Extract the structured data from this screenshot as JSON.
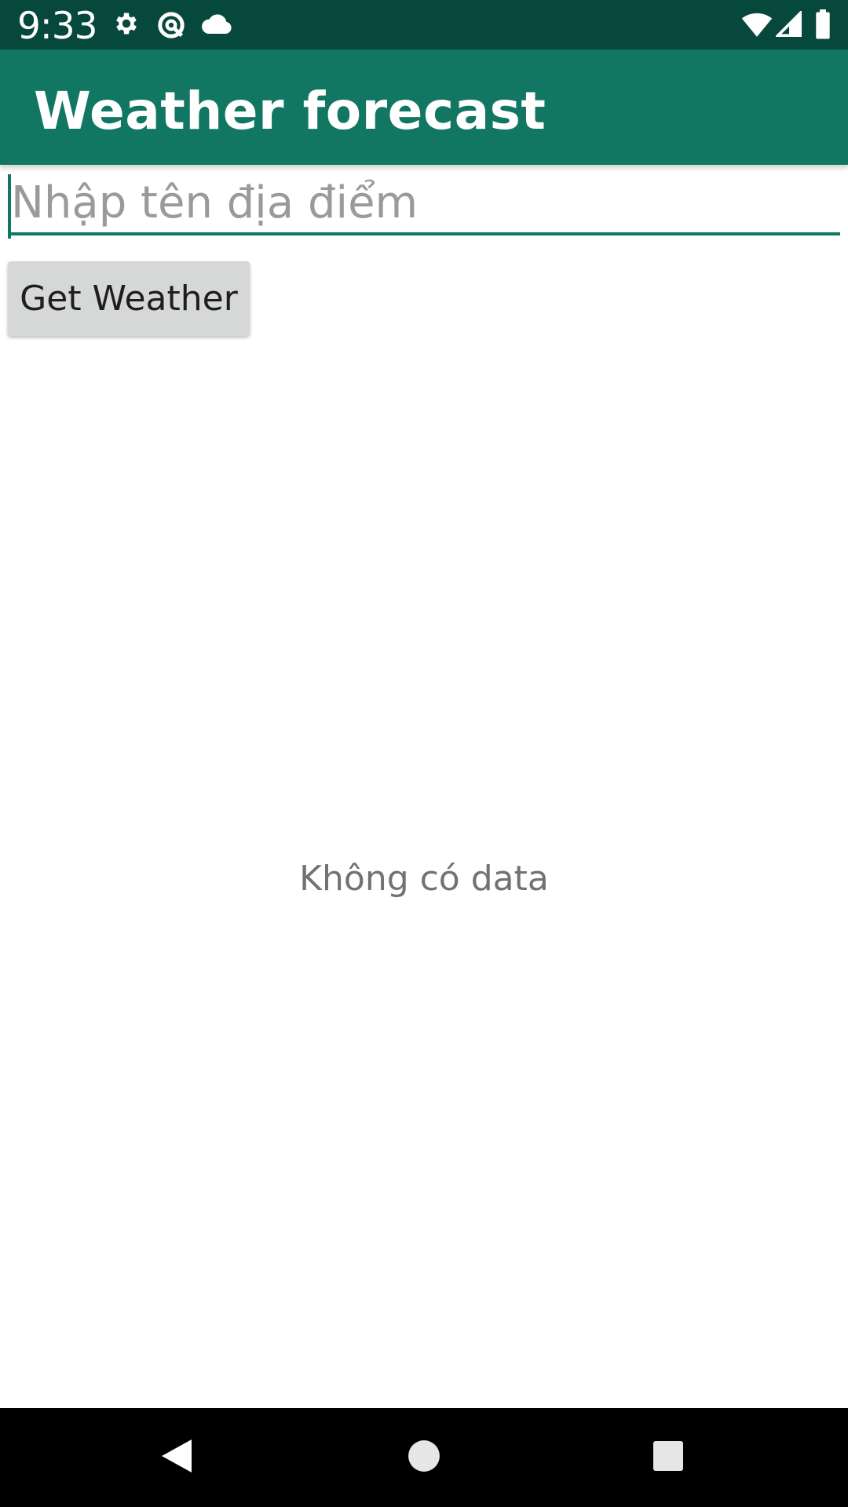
{
  "status_bar": {
    "time": "9:33",
    "icons": [
      "gear-icon",
      "vpn-key-icon",
      "cloud-icon",
      "wifi-icon",
      "cell-signal-icon",
      "battery-icon"
    ]
  },
  "app_bar": {
    "title": "Weather forecast",
    "color": "#117762"
  },
  "search": {
    "placeholder": "Nhập tên địa điểm",
    "value": ""
  },
  "actions": {
    "get_weather_label": "Get Weather"
  },
  "result": {
    "empty_text": "Không có data"
  },
  "nav_bar": {
    "icons": [
      "back-icon",
      "home-icon",
      "recents-icon"
    ]
  },
  "colors": {
    "status_bar": "#07483c",
    "accent": "#117762",
    "button_bg": "#d6d7d7"
  }
}
